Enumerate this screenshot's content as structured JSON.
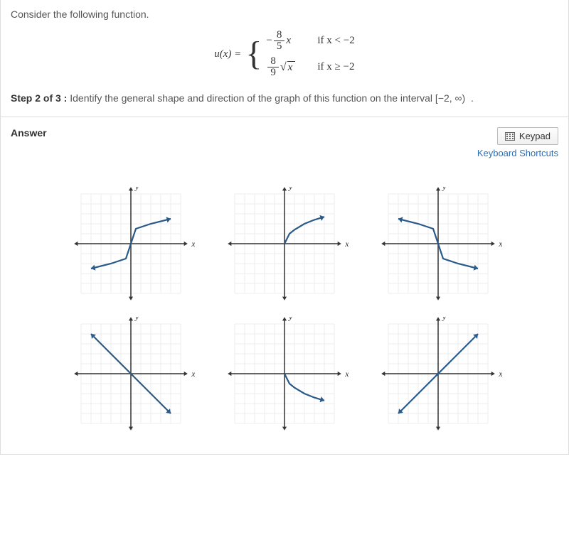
{
  "question": {
    "prompt": "Consider the following function.",
    "func_label": "u(x) =",
    "case1": {
      "neg": "−",
      "num": "8",
      "den": "5",
      "var": "x",
      "cond": "if x < −2"
    },
    "case2": {
      "num": "8",
      "den": "9",
      "radical": "√",
      "rad_arg": "x",
      "cond": "if x ≥ −2"
    },
    "step_label": "Step 2 of 3 :",
    "step_text": "Identify the general shape and direction of the graph of this function on the interval [−2, ∞)  ."
  },
  "answer": {
    "label": "Answer",
    "keypad_btn": "Keypad",
    "kb_shortcuts": "Keyboard Shortcuts"
  },
  "axis_labels": {
    "x": "x",
    "y": "y"
  },
  "chart_data": [
    {
      "type": "line",
      "id": "choice-1",
      "description": "cube-root-like curve, increasing, passes through origin with inflection",
      "x_range": [
        -5,
        5
      ],
      "y_range": [
        -5,
        5
      ],
      "points": [
        [
          -4,
          -2.5
        ],
        [
          -2,
          -2
        ],
        [
          -0.5,
          -1.5
        ],
        [
          0,
          0
        ],
        [
          0.5,
          1.5
        ],
        [
          2,
          2
        ],
        [
          4,
          2.5
        ]
      ]
    },
    {
      "type": "line",
      "id": "choice-2",
      "description": "principal square root curve, starts at origin, increases right",
      "x_range": [
        -5,
        5
      ],
      "y_range": [
        -5,
        5
      ],
      "points": [
        [
          0,
          0
        ],
        [
          0.5,
          1
        ],
        [
          1,
          1.4
        ],
        [
          2,
          2
        ],
        [
          3,
          2.4
        ],
        [
          4,
          2.7
        ]
      ]
    },
    {
      "type": "line",
      "id": "choice-3",
      "description": "reflected cube-root-like, decreasing left-to-right through origin",
      "x_range": [
        -5,
        5
      ],
      "y_range": [
        -5,
        5
      ],
      "points": [
        [
          -4,
          2.5
        ],
        [
          -2,
          2
        ],
        [
          -0.5,
          1.5
        ],
        [
          0,
          0
        ],
        [
          0.5,
          -1.5
        ],
        [
          2,
          -2
        ],
        [
          4,
          -2.5
        ]
      ]
    },
    {
      "type": "line",
      "id": "choice-4",
      "description": "straight line, negative slope through origin",
      "x_range": [
        -5,
        5
      ],
      "y_range": [
        -5,
        5
      ],
      "points": [
        [
          -4,
          4
        ],
        [
          4,
          -4
        ]
      ]
    },
    {
      "type": "line",
      "id": "choice-5",
      "description": "negative square root curve, starts at origin, decreases right",
      "x_range": [
        -5,
        5
      ],
      "y_range": [
        -5,
        5
      ],
      "points": [
        [
          0,
          0
        ],
        [
          0.5,
          -1
        ],
        [
          1,
          -1.4
        ],
        [
          2,
          -2
        ],
        [
          3,
          -2.4
        ],
        [
          4,
          -2.7
        ]
      ]
    },
    {
      "type": "line",
      "id": "choice-6",
      "description": "straight line, positive slope through origin",
      "x_range": [
        -5,
        5
      ],
      "y_range": [
        -5,
        5
      ],
      "points": [
        [
          -4,
          -4
        ],
        [
          4,
          4
        ]
      ]
    }
  ]
}
